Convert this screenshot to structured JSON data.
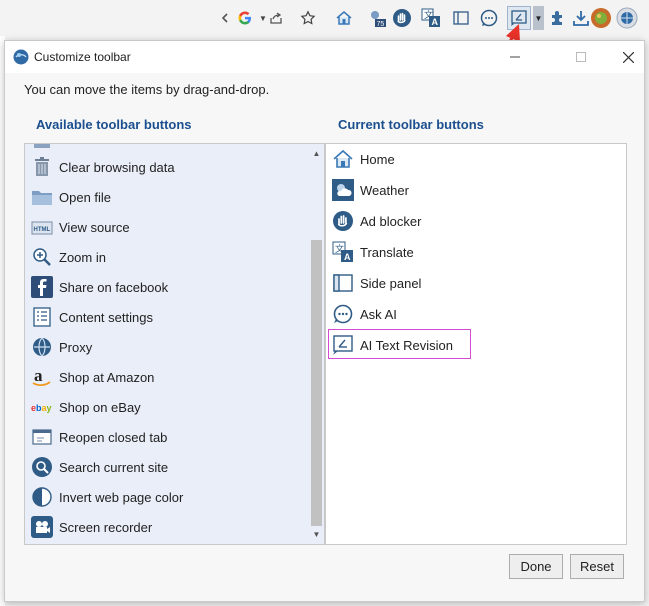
{
  "toolbar": {
    "icons": [
      "google-g",
      "share",
      "star",
      "home",
      "weather",
      "ad-blocker",
      "translate",
      "side-panel",
      "ask-ai",
      "ai-text-revision",
      "dropdown",
      "extensions",
      "download",
      "avatar",
      "settings"
    ]
  },
  "dialog": {
    "title": "Customize toolbar",
    "hint": "You can move the items by drag-and-drop.",
    "available_title": "Available toolbar buttons",
    "current_title": "Current toolbar buttons",
    "available_items": [
      {
        "label": "Clear browsing data",
        "icon": "trash-icon"
      },
      {
        "label": "Open file",
        "icon": "folder-icon"
      },
      {
        "label": "View source",
        "icon": "html-icon"
      },
      {
        "label": "Zoom in",
        "icon": "zoom-in-icon"
      },
      {
        "label": "Share on facebook",
        "icon": "facebook-icon"
      },
      {
        "label": "Content settings",
        "icon": "content-settings-icon"
      },
      {
        "label": "Proxy",
        "icon": "proxy-globe-icon"
      },
      {
        "label": "Shop at Amazon",
        "icon": "amazon-icon"
      },
      {
        "label": "Shop on eBay",
        "icon": "ebay-icon"
      },
      {
        "label": "Reopen closed tab",
        "icon": "reopen-tab-icon"
      },
      {
        "label": "Search current site",
        "icon": "search-icon"
      },
      {
        "label": "Invert web page color",
        "icon": "invert-color-icon"
      },
      {
        "label": "Screen recorder",
        "icon": "screen-recorder-icon"
      }
    ],
    "current_items": [
      {
        "label": "Home",
        "icon": "home-icon"
      },
      {
        "label": "Weather",
        "icon": "weather-icon"
      },
      {
        "label": "Ad blocker",
        "icon": "ad-blocker-icon"
      },
      {
        "label": "Translate",
        "icon": "translate-icon"
      },
      {
        "label": "Side panel",
        "icon": "side-panel-icon"
      },
      {
        "label": "Ask AI",
        "icon": "ask-ai-icon"
      },
      {
        "label": "AI Text Revision",
        "icon": "ai-text-revision-icon"
      }
    ],
    "done_label": "Done",
    "reset_label": "Reset"
  },
  "colors": {
    "section_title": "#1b4f8f",
    "available_bg": "#e9eef8",
    "highlight_border": "#d44bd4",
    "annotation_arrow": "#e8322a"
  }
}
